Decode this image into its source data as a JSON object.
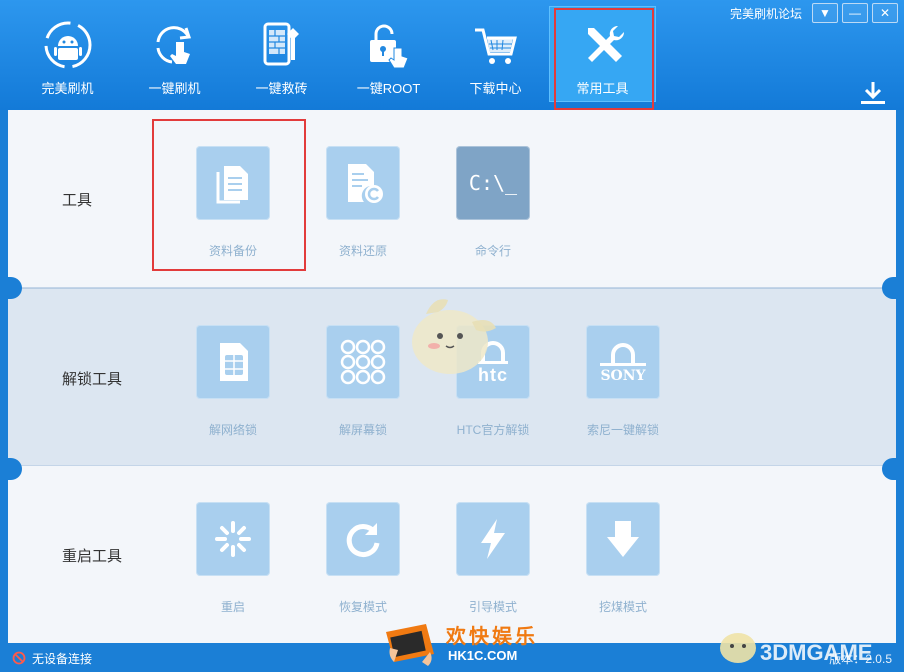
{
  "window": {
    "forum_link": "完美刷机论坛",
    "menu_btn": "▼",
    "min_btn": "—",
    "close_btn": "✕"
  },
  "nav": [
    {
      "label": "完美刷机",
      "icon": "android-icon"
    },
    {
      "label": "一键刷机",
      "icon": "refresh-touch-icon"
    },
    {
      "label": "一键救砖",
      "icon": "brick-phone-icon"
    },
    {
      "label": "一键ROOT",
      "icon": "unlock-icon"
    },
    {
      "label": "下载中心",
      "icon": "cart-icon"
    },
    {
      "label": "常用工具",
      "icon": "tools-icon",
      "active": true
    }
  ],
  "sections": {
    "tools": {
      "title": "工具",
      "items": [
        "资料备份",
        "资料还原",
        "命令行"
      ]
    },
    "unlock": {
      "title": "解锁工具",
      "items": [
        "解网络锁",
        "解屏幕锁",
        "HTC官方解锁",
        "索尼一键解锁"
      ]
    },
    "reboot": {
      "title": "重启工具",
      "items": [
        "重启",
        "恢复模式",
        "引导模式",
        "挖煤模式"
      ]
    }
  },
  "tile_text": {
    "cmd": "C:\\_",
    "htc": "htc",
    "sony": "SONY"
  },
  "status": {
    "device": "无设备连接",
    "version": "版本：2.0.5"
  },
  "watermarks": {
    "hk1c_cn": "欢快娱乐",
    "hk1c_en": "HK1C.COM",
    "threedm": "3DMGAME"
  },
  "colors": {
    "accent": "#1b7fd6",
    "highlight_box": "#e23b3b",
    "tile": "#a9cfee"
  }
}
